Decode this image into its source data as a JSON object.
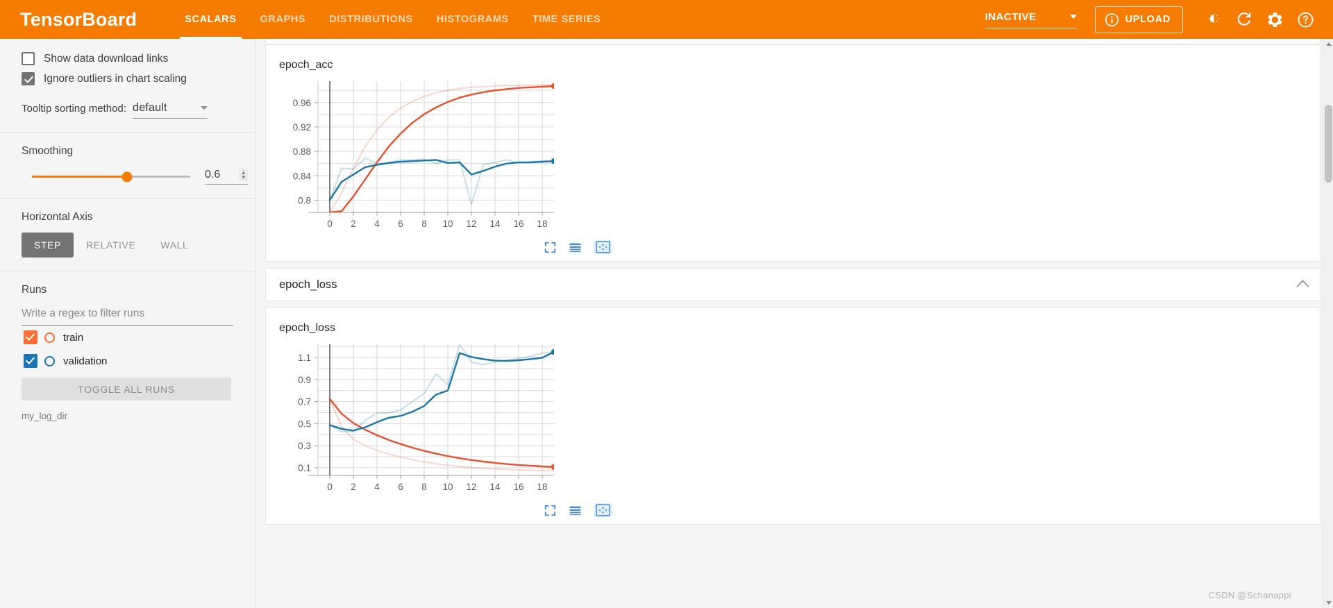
{
  "app": {
    "brand": "TensorBoard",
    "tabs": [
      {
        "label": "SCALARS",
        "active": true
      },
      {
        "label": "GRAPHS",
        "active": false
      },
      {
        "label": "DISTRIBUTIONS",
        "active": false
      },
      {
        "label": "HISTOGRAMS",
        "active": false
      },
      {
        "label": "TIME SERIES",
        "active": false
      }
    ],
    "run_status": "INACTIVE",
    "upload_label": "UPLOAD",
    "icons": [
      "info-icon",
      "brightness-icon",
      "refresh-icon",
      "settings-gear-icon",
      "help-icon"
    ],
    "accent_color": "#f57c00"
  },
  "sidebar": {
    "checkboxes": [
      {
        "label": "Show data download links",
        "checked": false
      },
      {
        "label": "Ignore outliers in chart scaling",
        "checked": true
      }
    ],
    "tooltip": {
      "label": "Tooltip sorting method:",
      "value": "default"
    },
    "smoothing": {
      "label": "Smoothing",
      "value": "0.6",
      "fraction": 0.6
    },
    "horizontal_axis": {
      "label": "Horizontal Axis",
      "options": [
        {
          "label": "STEP",
          "active": true
        },
        {
          "label": "RELATIVE",
          "active": false
        },
        {
          "label": "WALL",
          "active": false
        }
      ]
    },
    "runs": {
      "label": "Runs",
      "filter_placeholder": "Write a regex to filter runs",
      "items": [
        {
          "name": "train",
          "checked": true,
          "color": "#ff6f33"
        },
        {
          "name": "validation",
          "checked": true,
          "color": "#1975b5"
        }
      ],
      "toggle_all_label": "TOGGLE ALL RUNS",
      "logdir": "my_log_dir"
    }
  },
  "main": {
    "section_header_title": "epoch_loss",
    "collapse_icon": "chevron-up-icon",
    "toolbar_icons": [
      "expand-chart-icon",
      "data-table-icon",
      "fit-domain-icon"
    ],
    "watermark": "CSDN @Schanappi"
  },
  "chart_data": [
    {
      "type": "line",
      "title": "epoch_acc",
      "xlabel": "",
      "ylabel": "",
      "xlim": [
        -1,
        19
      ],
      "ylim": [
        0.78,
        0.995
      ],
      "xticks": [
        0,
        2,
        4,
        6,
        8,
        10,
        12,
        14,
        16,
        18
      ],
      "yticks": [
        0.8,
        0.84,
        0.88,
        0.92,
        0.96
      ],
      "grid": true,
      "legend": "none",
      "x": [
        0,
        1,
        2,
        3,
        4,
        5,
        6,
        7,
        8,
        9,
        10,
        11,
        12,
        13,
        14,
        15,
        16,
        17,
        18,
        19
      ],
      "series": [
        {
          "name": "train",
          "color": "#e8502e",
          "smoothed": [
            0.762,
            0.782,
            0.806,
            0.834,
            0.862,
            0.888,
            0.909,
            0.927,
            0.941,
            0.952,
            0.961,
            0.968,
            0.973,
            0.977,
            0.98,
            0.982,
            0.984,
            0.985,
            0.986,
            0.987
          ],
          "raw": [
            0.772,
            0.812,
            0.852,
            0.888,
            0.915,
            0.936,
            0.951,
            0.962,
            0.97,
            0.976,
            0.98,
            0.983,
            0.985,
            0.986,
            0.987,
            0.988,
            0.988,
            0.989,
            0.989,
            0.989
          ]
        },
        {
          "name": "validation",
          "color": "#1976a8",
          "smoothed": [
            0.8,
            0.83,
            0.842,
            0.854,
            0.858,
            0.861,
            0.863,
            0.864,
            0.865,
            0.866,
            0.861,
            0.862,
            0.842,
            0.848,
            0.855,
            0.86,
            0.862,
            0.862,
            0.863,
            0.864
          ],
          "raw": [
            0.8,
            0.852,
            0.851,
            0.869,
            0.86,
            0.862,
            0.866,
            0.866,
            0.867,
            0.86,
            0.866,
            0.866,
            0.793,
            0.858,
            0.862,
            0.866,
            0.861,
            0.863,
            0.864,
            0.864
          ]
        }
      ]
    },
    {
      "type": "line",
      "title": "epoch_loss",
      "xlabel": "",
      "ylabel": "",
      "xlim": [
        -1,
        19
      ],
      "ylim": [
        0.03,
        1.22
      ],
      "xticks": [
        0,
        2,
        4,
        6,
        8,
        10,
        12,
        14,
        16,
        18
      ],
      "yticks": [
        0.1,
        0.3,
        0.5,
        0.7,
        0.9,
        1.1
      ],
      "grid": true,
      "legend": "none",
      "x": [
        0,
        1,
        2,
        3,
        4,
        5,
        6,
        7,
        8,
        9,
        10,
        11,
        12,
        13,
        14,
        15,
        16,
        17,
        18,
        19
      ],
      "series": [
        {
          "name": "train",
          "color": "#e8502e",
          "smoothed": [
            0.725,
            0.59,
            0.505,
            0.445,
            0.395,
            0.352,
            0.315,
            0.282,
            0.253,
            0.228,
            0.205,
            0.186,
            0.17,
            0.156,
            0.144,
            0.133,
            0.125,
            0.118,
            0.112,
            0.107
          ],
          "raw": [
            0.725,
            0.47,
            0.36,
            0.3,
            0.258,
            0.224,
            0.196,
            0.172,
            0.152,
            0.136,
            0.122,
            0.111,
            0.102,
            0.095,
            0.089,
            0.084,
            0.08,
            0.077,
            0.075,
            0.074
          ]
        },
        {
          "name": "validation",
          "color": "#1976a8",
          "smoothed": [
            0.487,
            0.452,
            0.437,
            0.467,
            0.513,
            0.553,
            0.57,
            0.608,
            0.66,
            0.763,
            0.8,
            1.14,
            1.105,
            1.085,
            1.072,
            1.068,
            1.075,
            1.085,
            1.098,
            1.15
          ],
          "raw": [
            0.487,
            0.425,
            0.432,
            0.53,
            0.597,
            0.598,
            0.625,
            0.7,
            0.775,
            0.952,
            0.855,
            1.33,
            1.06,
            1.035,
            1.06,
            1.078,
            1.092,
            1.11,
            1.14,
            1.15
          ]
        }
      ]
    }
  ]
}
